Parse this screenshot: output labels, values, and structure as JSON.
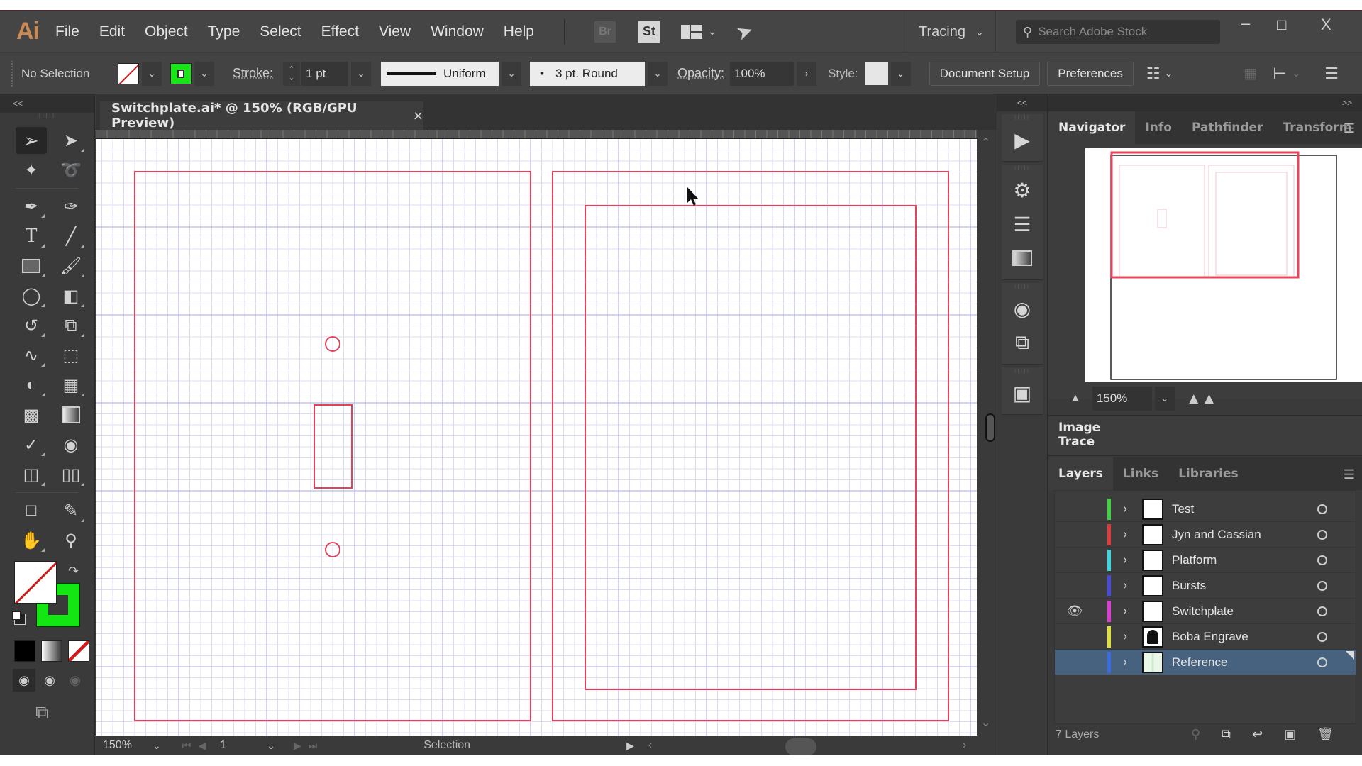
{
  "app": {
    "logo": "Ai",
    "menu": [
      "File",
      "Edit",
      "Object",
      "Type",
      "Select",
      "Effect",
      "View",
      "Window",
      "Help"
    ],
    "bridge_label": "Br",
    "stock_label": "St",
    "workspace": "Tracing",
    "search_placeholder": "Search Adobe Stock",
    "window_controls": {
      "minimize": "–",
      "maximize": "□",
      "close": "X"
    }
  },
  "control_bar": {
    "selection_status": "No Selection",
    "stroke_label": "Stroke:",
    "stroke_weight": "1 pt",
    "variable_width": "Uniform",
    "brush": "3 pt. Round",
    "opacity_label": "Opacity:",
    "opacity_value": "100%",
    "style_label": "Style:",
    "document_setup": "Document Setup",
    "preferences": "Preferences",
    "colors": {
      "fill": "none",
      "stroke": "#19e619"
    }
  },
  "toolbar": {
    "collapse": "<<",
    "tools": [
      [
        "selection-tool",
        "direct-selection-tool"
      ],
      [
        "magic-wand-tool",
        "lasso-tool"
      ],
      [
        "pen-tool",
        "curvature-tool"
      ],
      [
        "type-tool",
        "line-segment-tool"
      ],
      [
        "rectangle-tool",
        "paintbrush-tool"
      ],
      [
        "shaper-tool",
        "eraser-tool"
      ],
      [
        "rotate-tool",
        "scale-tool"
      ],
      [
        "warp-tool",
        "free-transform-tool"
      ],
      [
        "shape-builder-tool",
        "perspective-grid-tool"
      ],
      [
        "mesh-tool",
        "gradient-tool"
      ],
      [
        "eyedropper-tool",
        "blend-tool"
      ],
      [
        "symbol-sprayer-tool",
        "graph-tool"
      ],
      [
        "artboard-tool",
        "slice-tool"
      ],
      [
        "hand-tool",
        "zoom-tool"
      ]
    ],
    "active_tool": "selection-tool"
  },
  "document": {
    "tab_title": "Switchplate.ai* @ 150% (RGB/GPU Preview)",
    "close": "×",
    "artwork_color": "#e0435a",
    "grid_minor_color": "#dcdcf0",
    "grid_major_color": "#a9a9e6"
  },
  "status_bar": {
    "zoom": "150%",
    "artboard_number": "1",
    "current_tool": "Selection"
  },
  "navigator": {
    "tabs": [
      "Navigator",
      "Info",
      "Pathfinder",
      "Transform"
    ],
    "active_tab": "Navigator",
    "zoom": "150%",
    "view_box_color": "#e8455d"
  },
  "image_trace": {
    "title": "Image Trace"
  },
  "layers": {
    "tabs": [
      "Layers",
      "Links",
      "Libraries"
    ],
    "active_tab": "Layers",
    "items": [
      {
        "name": "Test",
        "color": "#3fd23f",
        "visible": false,
        "selected": false
      },
      {
        "name": "Jyn and Cassian",
        "color": "#e03a3a",
        "visible": false,
        "selected": false
      },
      {
        "name": "Platform",
        "color": "#3ad8e0",
        "visible": false,
        "selected": false
      },
      {
        "name": "Bursts",
        "color": "#4a4ae0",
        "visible": false,
        "selected": false
      },
      {
        "name": "Switchplate",
        "color": "#e03ad8",
        "visible": true,
        "selected": false
      },
      {
        "name": "Boba Engrave",
        "color": "#e0e03a",
        "visible": false,
        "selected": false
      },
      {
        "name": "Reference",
        "color": "#3a6ae0",
        "visible": false,
        "selected": true
      }
    ],
    "count_label": "7 Layers"
  }
}
